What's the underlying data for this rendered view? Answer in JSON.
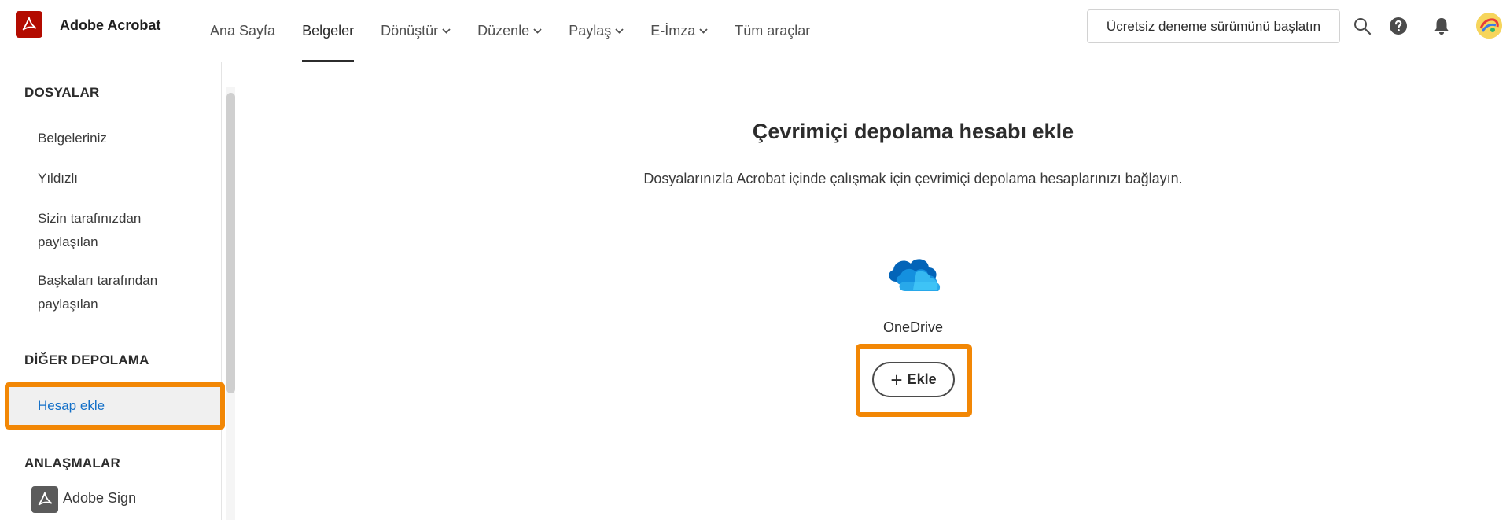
{
  "header": {
    "app_name": "Adobe Acrobat",
    "nav": [
      {
        "label": "Ana Sayfa",
        "dropdown": false,
        "active": false
      },
      {
        "label": "Belgeler",
        "dropdown": false,
        "active": true
      },
      {
        "label": "Dönüştür",
        "dropdown": true,
        "active": false
      },
      {
        "label": "Düzenle",
        "dropdown": true,
        "active": false
      },
      {
        "label": "Paylaş",
        "dropdown": true,
        "active": false
      },
      {
        "label": "E-İmza",
        "dropdown": true,
        "active": false
      },
      {
        "label": "Tüm araçlar",
        "dropdown": false,
        "active": false
      }
    ],
    "trial_button": "Ücretsiz deneme sürümünü başlatın",
    "icons": [
      "search-icon",
      "help-icon",
      "bell-icon",
      "avatar"
    ]
  },
  "sidebar": {
    "files_heading": "DOSYALAR",
    "files_items": [
      "Belgeleriniz",
      "Yıldızlı",
      "Sizin tarafınızdan paylaşılan",
      "Başkaları tarafından paylaşılan"
    ],
    "other_storage_heading": "DİĞER DEPOLAMA",
    "add_account": "Hesap ekle",
    "agreements_heading": "ANLAŞMALAR",
    "adobe_sign": "Adobe Sign"
  },
  "main": {
    "title": "Çevrimiçi depolama hesabı ekle",
    "subtitle": "Dosyalarınızla Acrobat içinde çalışmak için çevrimiçi depolama hesaplarınızı bağlayın.",
    "service_name": "OneDrive",
    "add_button": "Ekle"
  },
  "colors": {
    "brand_red": "#b30b00",
    "highlight_orange": "#f28705",
    "link_blue": "#1470c8",
    "onedrive_blue": "#0364b8"
  }
}
